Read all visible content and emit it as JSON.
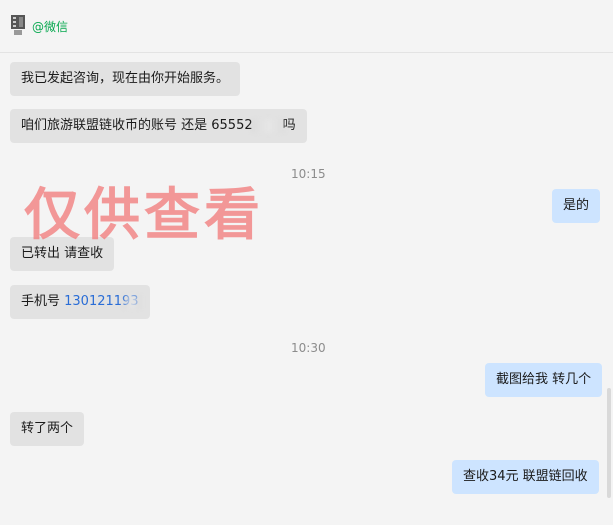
{
  "header": {
    "contact_tag": "@微信"
  },
  "watermark": "仅供查看",
  "messages": {
    "m1": "我已发起咨询，现在由你开始服务。",
    "m2_prefix": "咱们旅游联盟链收币的账号 还是 65552",
    "m2_suffix": "吗",
    "time1": "10:15",
    "m3": "是的",
    "m4": "已转出 请查收",
    "m5_prefix": "手机号 ",
    "m5_phone": "130121193",
    "time2": "10:30",
    "m6": "截图给我  转几个",
    "m7": "转了两个",
    "m8": "查收34元   联盟链回收"
  },
  "colors": {
    "incoming_bubble": "#e2e2e2",
    "outgoing_bubble": "#cde4ff",
    "wechat_green": "#07a84f",
    "watermark": "#f27878"
  }
}
